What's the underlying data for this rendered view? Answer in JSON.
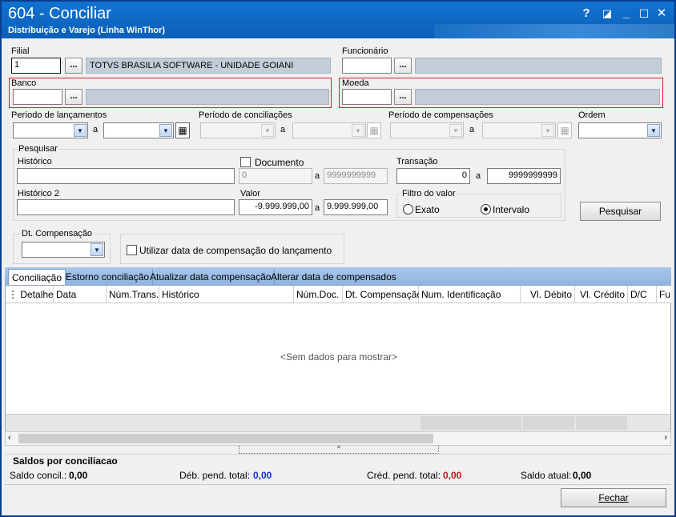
{
  "window": {
    "title": "604 - Conciliar",
    "subtitle": "Distribuição e Varejo (Linha WinThor)",
    "controls": {
      "help": "?",
      "restore": "◪",
      "minimize": "_",
      "maximize": "☐",
      "close": "✕"
    }
  },
  "filial": {
    "label": "Filial",
    "value": "1",
    "button": "...",
    "name": "TOTVS BRASILIA SOFTWARE - UNIDADE GOIANI"
  },
  "funcionario": {
    "label": "Funcionário",
    "value": "",
    "button": "...",
    "name": ""
  },
  "banco": {
    "label": "Banco",
    "value": "",
    "button": "...",
    "name": ""
  },
  "moeda": {
    "label": "Moeda",
    "value": "",
    "button": "...",
    "name": ""
  },
  "periodos": {
    "lancamentos": {
      "label": "Período de lançamentos",
      "sep": "a"
    },
    "conciliacoes": {
      "label": "Período de conciliações",
      "sep": "a"
    },
    "compensacoes": {
      "label": "Período de compensações",
      "sep": "a"
    },
    "ordem": {
      "label": "Ordem",
      "value": ""
    }
  },
  "pesquisar": {
    "title": "Pesquisar",
    "historico_label": "Histórico",
    "historico2_label": "Histórico 2",
    "documento_label": "Documento",
    "documento_from": "0",
    "documento_sep": "a",
    "documento_to": "9999999999",
    "transacao_label": "Transação",
    "transacao_from": "0",
    "transacao_sep": "a",
    "transacao_to": "9999999999",
    "valor_label": "Valor",
    "valor_from": "-9.999.999,00",
    "valor_sep": "a",
    "valor_to": "9.999.999,00",
    "filtro_label": "Filtro do valor",
    "filtro_exato": "Exato",
    "filtro_intervalo": "Intervalo"
  },
  "search_button": "Pesquisar",
  "dt_compensacao": {
    "title": "Dt. Compensação",
    "value": ""
  },
  "utilizar_data": "Utilizar data de compensação do lançamento",
  "tabs": [
    "Conciliação",
    "Estorno conciliação",
    "Atualizar data compensação",
    "Alterar data de compensados"
  ],
  "grid": {
    "columns": [
      "Detalhe",
      "Data",
      "Núm.Trans.",
      "Histórico",
      "Núm.Doc.",
      "Dt. Compensação",
      "Num. Identificação",
      "Vl. Débito",
      "Vl. Crédito",
      "D/C",
      "Fu"
    ],
    "empty": "<Sem dados para mostrar>"
  },
  "saldos": {
    "title": "Saldos por conciliacao",
    "concil_label": "Saldo concil.:",
    "concil_value": "0,00",
    "deb_label": "Déb. pend. total:",
    "deb_value": "0,00",
    "cred_label": "Créd. pend. total:",
    "cred_value": "0,00",
    "atual_label": "Saldo atual:",
    "atual_value": "0,00"
  },
  "fechar_button": "Fechar",
  "colors": {
    "deb": "#1030d0",
    "cred": "#c01818",
    "highlight": "#d3222a"
  }
}
